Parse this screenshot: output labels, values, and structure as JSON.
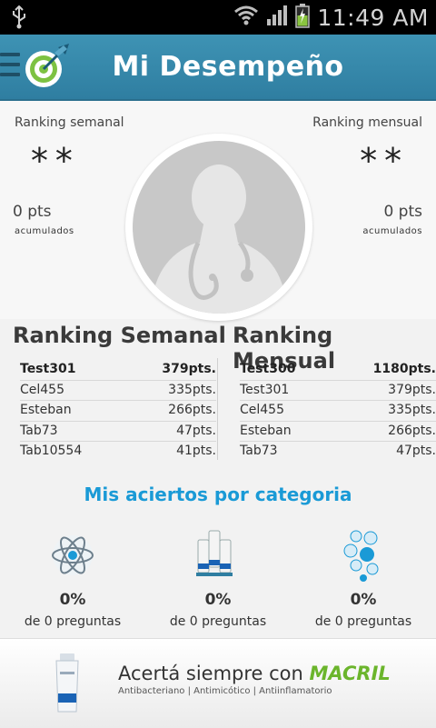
{
  "status": {
    "time": "11:49 AM",
    "icons": [
      "usb-icon",
      "wifi-icon",
      "signal-icon",
      "battery-charging-icon"
    ]
  },
  "header": {
    "title": "Mi Desempeño",
    "menu_icon": "menu-icon",
    "logo_icon": "target-wing-logo"
  },
  "stats": {
    "weekly": {
      "label": "Ranking semanal",
      "rank": "**",
      "points": "0 pts",
      "points_sub": "acumulados"
    },
    "monthly": {
      "label": "Ranking mensual",
      "rank": "**",
      "points": "0 pts",
      "points_sub": "acumulados"
    }
  },
  "rankings": {
    "weekly": {
      "title": "Ranking Semanal",
      "rows": [
        {
          "name": "Test301",
          "points": "379pts."
        },
        {
          "name": "Cel455",
          "points": "335pts."
        },
        {
          "name": "Esteban",
          "points": "266pts."
        },
        {
          "name": "Tab73",
          "points": "47pts."
        },
        {
          "name": "Tab10554",
          "points": "41pts."
        }
      ]
    },
    "monthly": {
      "title": "Ranking Mensual",
      "rows": [
        {
          "name": "Test300",
          "points": "1180pts."
        },
        {
          "name": "Test301",
          "points": "379pts."
        },
        {
          "name": "Cel455",
          "points": "335pts."
        },
        {
          "name": "Esteban",
          "points": "266pts."
        },
        {
          "name": "Tab73",
          "points": "47pts."
        }
      ]
    }
  },
  "categories": {
    "title": "Mis aciertos por categoria",
    "items": [
      {
        "icon": "atom-icon",
        "percent": "0%",
        "subtitle": "de 0 preguntas"
      },
      {
        "icon": "medicine-tubes-icon",
        "percent": "0%",
        "subtitle": "de 0 preguntas"
      },
      {
        "icon": "science-bubbles-icon",
        "percent": "0%",
        "subtitle": "de 0 preguntas"
      }
    ]
  },
  "ad": {
    "slogan": "Acertá siempre con ",
    "brand": "MACRIL",
    "tagline": "Antibacteriano | Antimicótico | Antiinflamatorio"
  },
  "colors": {
    "header": "#3a8db0",
    "accent": "#1a9ad6",
    "brand": "#6bb52c"
  }
}
